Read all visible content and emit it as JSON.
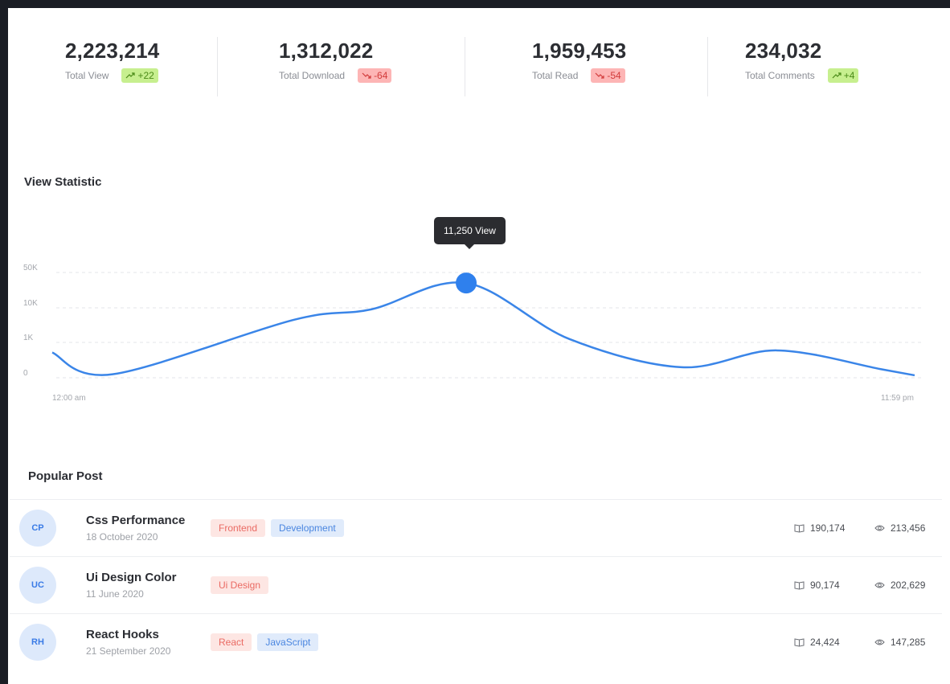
{
  "stats": [
    {
      "value": "2,223,214",
      "label": "Total View",
      "change": "+22",
      "trend": "up"
    },
    {
      "value": "1,312,022",
      "label": "Total Download",
      "change": "-64",
      "trend": "down"
    },
    {
      "value": "1,959,453",
      "label": "Total Read",
      "change": "-54",
      "trend": "down"
    },
    {
      "value": "234,032",
      "label": "Total Comments",
      "change": "+4",
      "trend": "up"
    }
  ],
  "view_statistic": {
    "title": "View Statistic",
    "tooltip": "11,250 View"
  },
  "chart_data": {
    "type": "line",
    "title": "View Statistic",
    "y_ticks": [
      "50K",
      "10K",
      "1K",
      "0"
    ],
    "x_ticks": [
      "12:00 am",
      "11:59 pm"
    ],
    "grid": true,
    "y_scale": "non-linear",
    "series": [
      {
        "values": [
          [
            0.0,
            0.72
          ],
          [
            0.07,
            0.1
          ],
          [
            0.28,
            1.65
          ],
          [
            0.37,
            1.95
          ],
          [
            0.48,
            2.7
          ],
          [
            0.6,
            1.1
          ],
          [
            0.73,
            0.3
          ],
          [
            0.84,
            0.78
          ],
          [
            0.96,
            0.25
          ],
          [
            1.0,
            0.07
          ]
        ]
      }
    ],
    "highlight": {
      "x": 0.48,
      "label": "11,250 View"
    },
    "colors": {
      "line": "#3a85e8",
      "marker": "#2f80ed"
    }
  },
  "popular_post": {
    "title": "Popular Post",
    "rows": [
      {
        "initials": "CP",
        "title": "Css Performance",
        "date": "18 October 2020",
        "tags": [
          {
            "label": "Frontend",
            "color": "red"
          },
          {
            "label": "Development",
            "color": "blue"
          }
        ],
        "reads": "190,174",
        "views": "213,456"
      },
      {
        "initials": "UC",
        "title": "Ui Design Color",
        "date": "11 June 2020",
        "tags": [
          {
            "label": "Ui Design",
            "color": "red"
          }
        ],
        "reads": "90,174",
        "views": "202,629"
      },
      {
        "initials": "RH",
        "title": "React Hooks",
        "date": "21 September 2020",
        "tags": [
          {
            "label": "React",
            "color": "red"
          },
          {
            "label": "JavaScript",
            "color": "blue"
          }
        ],
        "reads": "24,424",
        "views": "147,285"
      }
    ]
  },
  "icons": {
    "trend_up": "trend-up-icon",
    "trend_down": "trend-down-icon",
    "reads": "book-icon",
    "views": "eye-icon"
  },
  "colors": {
    "accent": "#3a85e8",
    "up": "#c7ef8f",
    "down": "#fdb5b5",
    "background": "#1a1d24",
    "card": "#ffffff"
  }
}
